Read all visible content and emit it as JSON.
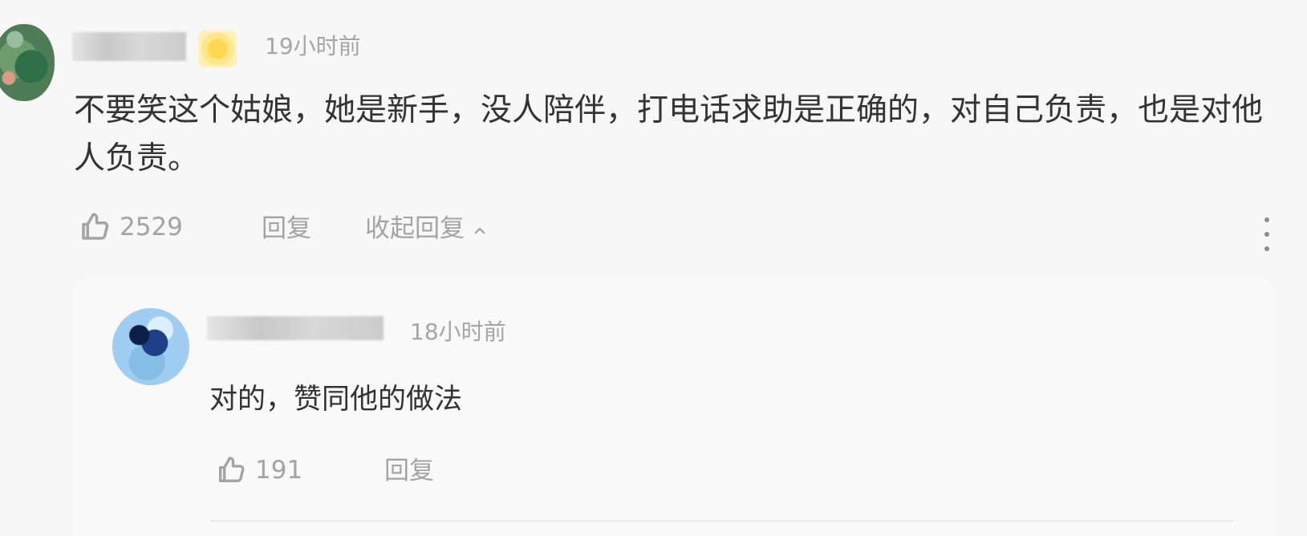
{
  "colors": {
    "background": "#f7f7f7",
    "text_primary": "#333333",
    "text_secondary": "#a3a3a3",
    "divider": "#e9e9e9"
  },
  "comment": {
    "timestamp": "19小时前",
    "content": "不要笑这个姑娘，她是新手，没人陪伴，打电话求助是正确的，对自己负责，也是对他人负责。",
    "likes": "2529",
    "reply_label": "回复",
    "collapse_label": "收起回复",
    "icons": {
      "like": "thumbs-up-icon",
      "collapse": "chevron-up-icon",
      "more": "more-vertical-icon"
    }
  },
  "reply": {
    "timestamp": "18小时前",
    "content": "对的，赞同他的做法",
    "likes": "191",
    "reply_label": "回复",
    "icons": {
      "like": "thumbs-up-icon"
    }
  }
}
